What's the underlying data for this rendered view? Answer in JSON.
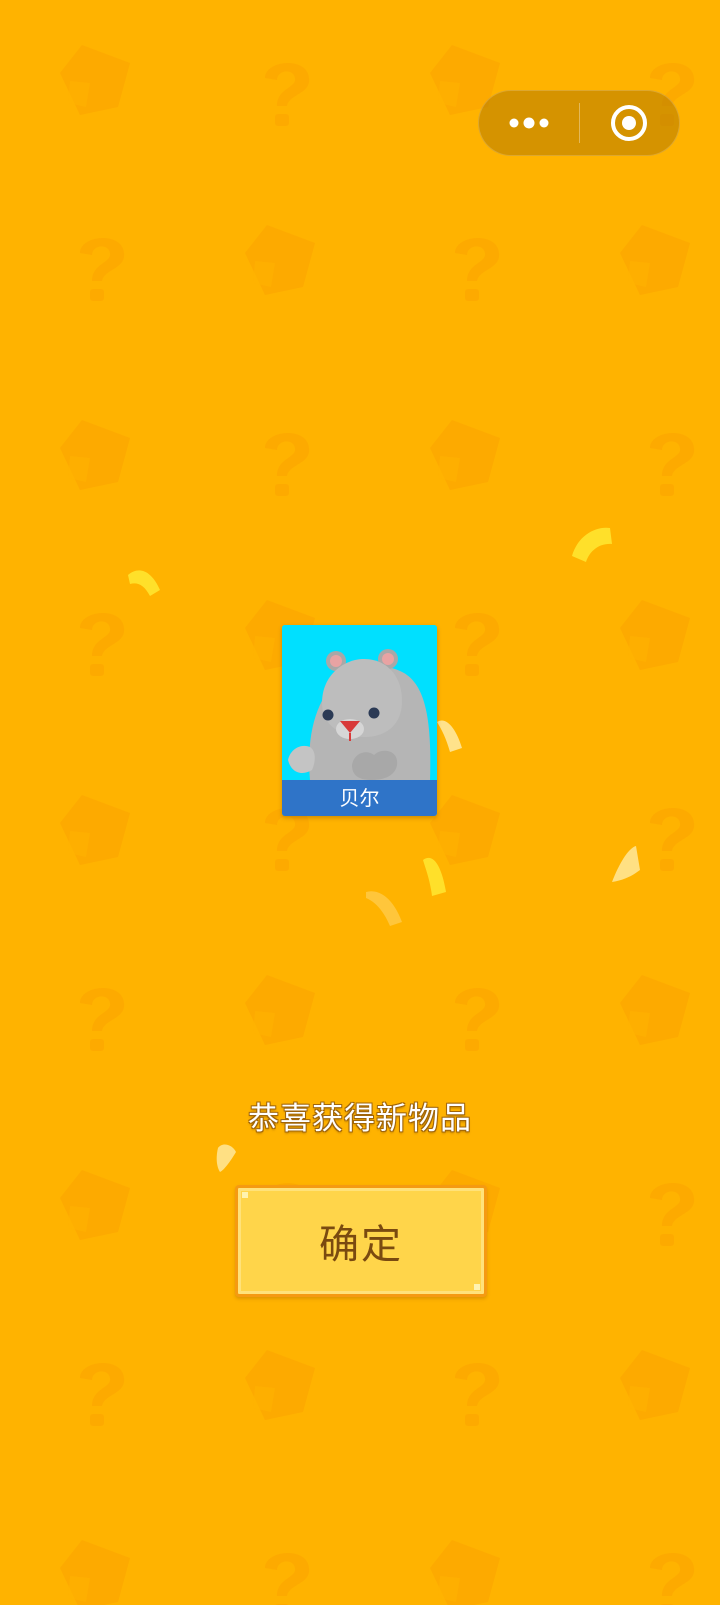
{
  "capsule": {
    "more_icon": "more-dots-icon",
    "close_icon": "target-circle-icon"
  },
  "reward": {
    "item_name": "贝尔",
    "item_icon": "gray-bear-portrait",
    "message": "恭喜获得新物品",
    "confirm_label": "确定"
  },
  "colors": {
    "background": "#FFB300",
    "card_background": "#00E0FF",
    "name_bar": "#2F74C8",
    "button_fill": "#FFD54A",
    "button_border": "#F59A12",
    "button_text": "#7A4A10"
  }
}
